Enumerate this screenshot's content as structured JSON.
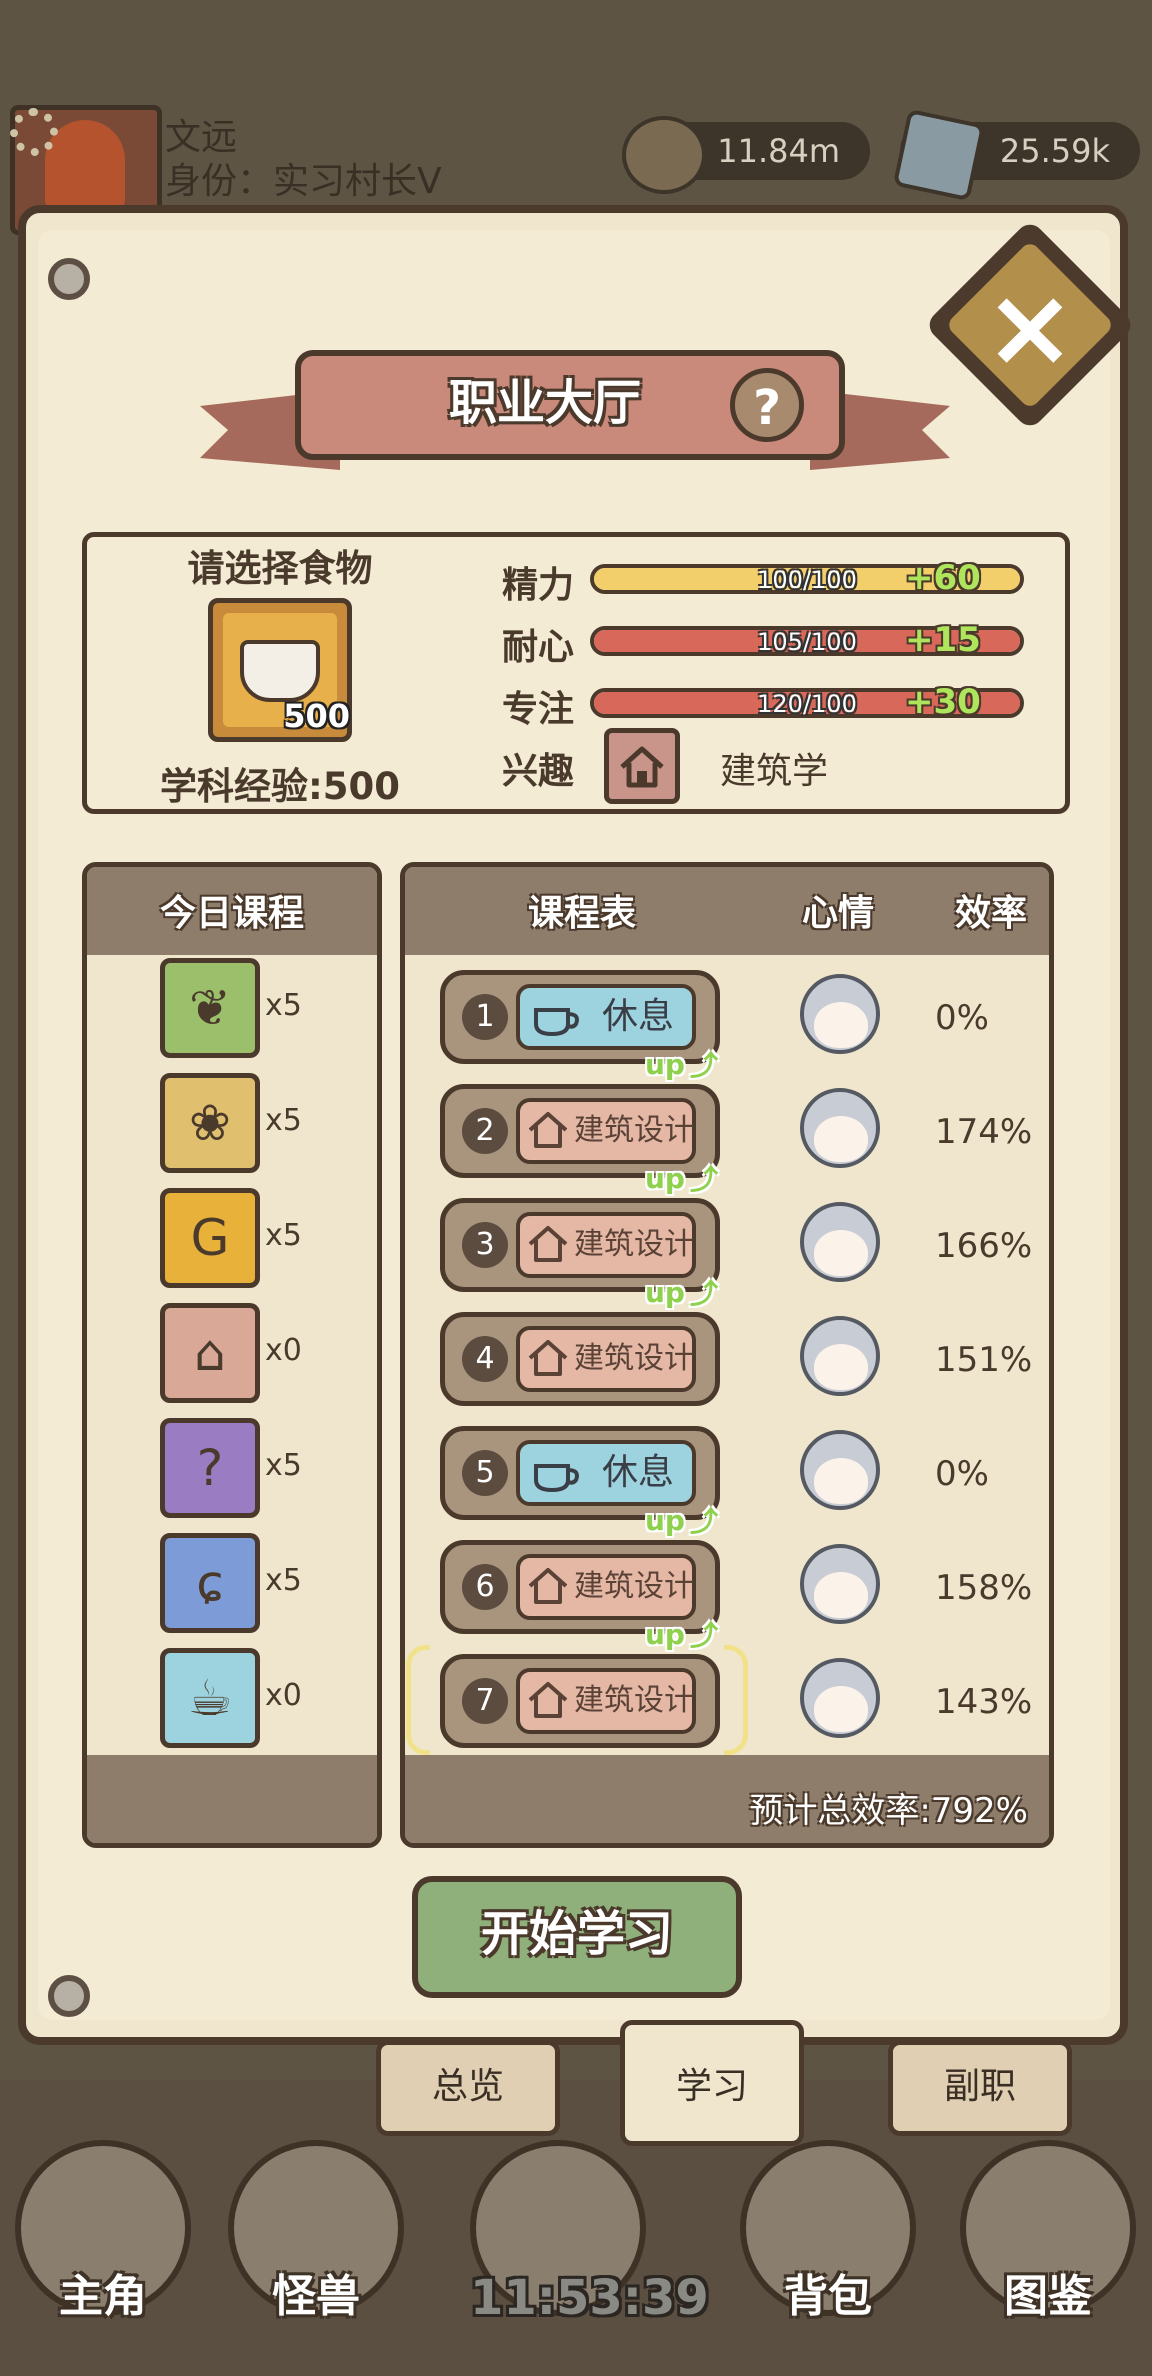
{
  "player": {
    "name": "文远",
    "role": "身份：实习村长Ⅴ"
  },
  "resources": {
    "coins": "11.84m",
    "stones": "25.59k"
  },
  "window": {
    "title": "职业大厅",
    "help_icon": "?",
    "close_icon": "×"
  },
  "food": {
    "label": "请选择食物",
    "count": "500",
    "exp_label": "学科经验:500"
  },
  "stats": [
    {
      "label": "精力",
      "value": "100/100",
      "bonus": "+60",
      "fill": 1.0,
      "color": "#f3cf6b"
    },
    {
      "label": "耐心",
      "value": "105/100",
      "bonus": "+15",
      "fill": 1.0,
      "color": "#d8685a"
    },
    {
      "label": "专注",
      "value": "120/100",
      "bonus": "+30",
      "fill": 1.0,
      "color": "#d8685a"
    }
  ],
  "interest": {
    "label": "兴趣",
    "value": "建筑学"
  },
  "today": {
    "title": "今日课程",
    "items": [
      {
        "icon": "leaf-icon",
        "glyph": "❦",
        "color": "#9bbf6b",
        "count": "x5"
      },
      {
        "icon": "paw-icon",
        "glyph": "❀",
        "color": "#e0c06e",
        "count": "x5"
      },
      {
        "icon": "money-bag-icon",
        "glyph": "G",
        "color": "#e8b23a",
        "count": "x5"
      },
      {
        "icon": "house-icon",
        "glyph": "⌂",
        "color": "#d9a896",
        "count": "x0"
      },
      {
        "icon": "potion-icon",
        "glyph": "?",
        "color": "#9a7cc2",
        "count": "x5"
      },
      {
        "icon": "magic-icon",
        "glyph": "ɕ",
        "color": "#7d9bd6",
        "count": "x5"
      },
      {
        "icon": "cup-icon",
        "glyph": "☕",
        "color": "#9dd3df",
        "count": "x0"
      }
    ]
  },
  "schedule": {
    "title": "课程表",
    "mood_header": "心情",
    "eff_header": "效率",
    "up_label": "up",
    "rows": [
      {
        "num": "1",
        "course": "休息",
        "type": "rest",
        "up": false,
        "eff": "0%"
      },
      {
        "num": "2",
        "course": "建筑设计",
        "type": "build",
        "up": true,
        "eff": "174%"
      },
      {
        "num": "3",
        "course": "建筑设计",
        "type": "build",
        "up": true,
        "eff": "166%"
      },
      {
        "num": "4",
        "course": "建筑设计",
        "type": "build",
        "up": true,
        "eff": "151%"
      },
      {
        "num": "5",
        "course": "休息",
        "type": "rest",
        "up": false,
        "eff": "0%"
      },
      {
        "num": "6",
        "course": "建筑设计",
        "type": "build",
        "up": true,
        "eff": "158%"
      },
      {
        "num": "7",
        "course": "建筑设计",
        "type": "build",
        "up": true,
        "eff": "143%"
      }
    ],
    "total": "预计总效率:792%"
  },
  "start_button": "开始学习",
  "tabs": [
    "总览",
    "学习",
    "副职"
  ],
  "nav": [
    "主角",
    "怪兽",
    "背包",
    "图鉴"
  ],
  "clock": "11:53:39"
}
